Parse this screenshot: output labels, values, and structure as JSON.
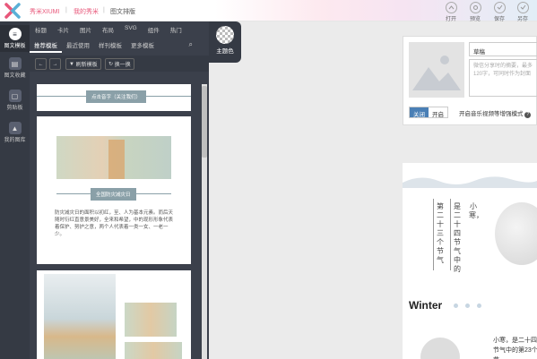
{
  "topbar": {
    "brand": "秀米XIUMI",
    "my_xiumi": "我的秀米",
    "page": "图文排版",
    "tools": [
      {
        "label": "打开",
        "icon": "open-icon"
      },
      {
        "label": "预览",
        "icon": "preview-icon"
      },
      {
        "label": "保存",
        "icon": "save-icon"
      },
      {
        "label": "另存",
        "icon": "save-as-icon"
      }
    ]
  },
  "rail": {
    "items": [
      {
        "label": "图文模板",
        "icon": "menu-icon"
      },
      {
        "label": "图文收藏",
        "icon": "collection-icon"
      },
      {
        "label": "剪贴板",
        "icon": "clipboard-icon"
      },
      {
        "label": "我的图库",
        "icon": "gallery-icon"
      }
    ]
  },
  "panel": {
    "tabs_primary": [
      "标题",
      "卡片",
      "图片",
      "布局",
      "SVG",
      "组件",
      "热门"
    ],
    "tabs_secondary": [
      "推荐模板",
      "最近使用",
      "样刊模板",
      "更多模板"
    ],
    "refresh_label": "刷新模板",
    "shuffle_label": "换一换",
    "card1_label": "点击音字（关注我们）",
    "card2_label": "全国防灾减灾日",
    "card2_text": "防灾减灾日的面积以初红，至、人为基本元素。而后天随时衍红直意景美好，全来和希望，中的现形形象代表着保护、努护之意，两个人代表着一类一女、一老一少。"
  },
  "theme": {
    "label": "主题色"
  },
  "meta": {
    "title_value": "草稿",
    "summary_placeholder": "微信分享时的摘要，最多120字，可同时作为封面",
    "toggle_off": "关闭",
    "toggle_on": "开启",
    "toggle_text": "开启音乐视频等增强模式"
  },
  "article": {
    "vert_col1": "第二十三个节气",
    "vert_col2": "是二十四节气中的",
    "vert_col3": "小寒，",
    "winter": "Winter",
    "xiaohan": "小寒，是二十四节气中的第23个节"
  }
}
